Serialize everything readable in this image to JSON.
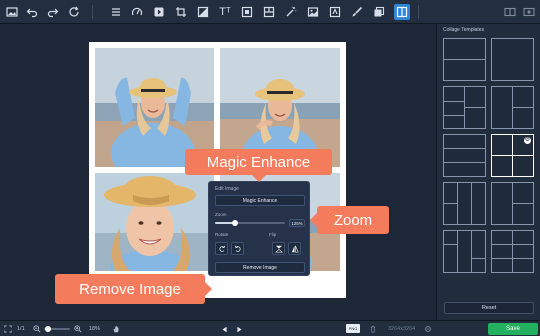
{
  "toolbar": {
    "icons": [
      "photo-icon",
      "undo-icon",
      "redo-icon",
      "refresh-icon",
      "menu-icon",
      "speedometer-icon",
      "enhance-icon",
      "crop-icon",
      "adjust-icon",
      "text-icon",
      "frame-icon",
      "layout-icon",
      "magic-wand-icon",
      "image-icon",
      "effects-icon",
      "brush-icon",
      "background-icon",
      "collage-icon"
    ],
    "text_tool_label": "Tᵀ",
    "right_icons": [
      "compare-icon",
      "eye-icon"
    ]
  },
  "edit_panel": {
    "title": "Edit Image",
    "magic_enhance": "Magic Enhance",
    "zoom_label": "Zoom",
    "zoom_value": "125%",
    "zoom_fraction": 0.28,
    "rotate_label": "Rotate",
    "flip_label": "Flip",
    "remove_image": "Remove Image"
  },
  "callouts": {
    "magic": "Magic Enhance",
    "zoom": "Zoom",
    "remove": "Remove Image"
  },
  "bottom": {
    "fit_icon": "fit-screen-icon",
    "page": "1/1",
    "zoom_percent": "18%",
    "zoom_fraction": 0.15,
    "hand_icon": "hand-icon",
    "prev_icon": "play-left-icon",
    "next_icon": "play-right-icon",
    "toggle_label": "PNG",
    "dimensions": "3264x3264",
    "save": "Save"
  },
  "sidebar": {
    "title": "Collage Templates",
    "reset": "Reset",
    "selected_index": 5
  },
  "colors": {
    "accent": "#2f86d8",
    "callout": "#f47c5c",
    "save": "#23b05f"
  }
}
